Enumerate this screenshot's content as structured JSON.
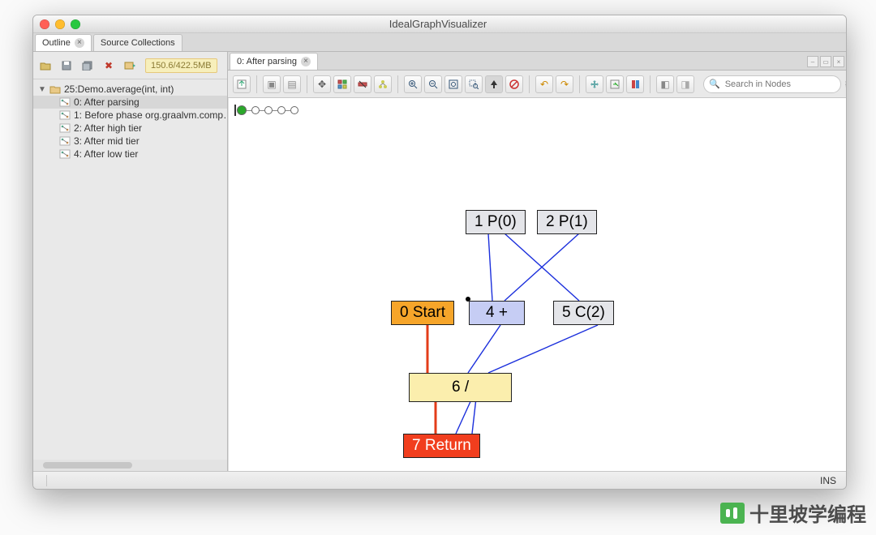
{
  "window_title": "IdealGraphVisualizer",
  "sidebar_tabs": {
    "outline": "Outline",
    "source_collections": "Source Collections"
  },
  "memory": "150.6/422.5MB",
  "tree": {
    "root": "25:Demo.average(int, int)",
    "items": [
      "0: After parsing",
      "1: Before phase org.graalvm.comp…",
      "2: After high tier",
      "3: After mid tier",
      "4: After low tier"
    ]
  },
  "doc_tab": "0: After parsing",
  "search_placeholder": "Search in Nodes",
  "status_ins": "INS",
  "graph": {
    "p0": "1 P(0)",
    "p1": "2 P(1)",
    "start": "0 Start",
    "plus": "4 +",
    "c2": "5 C(2)",
    "div": "6 /",
    "ret": "7 Return"
  },
  "watermark": "十里坡学编程"
}
